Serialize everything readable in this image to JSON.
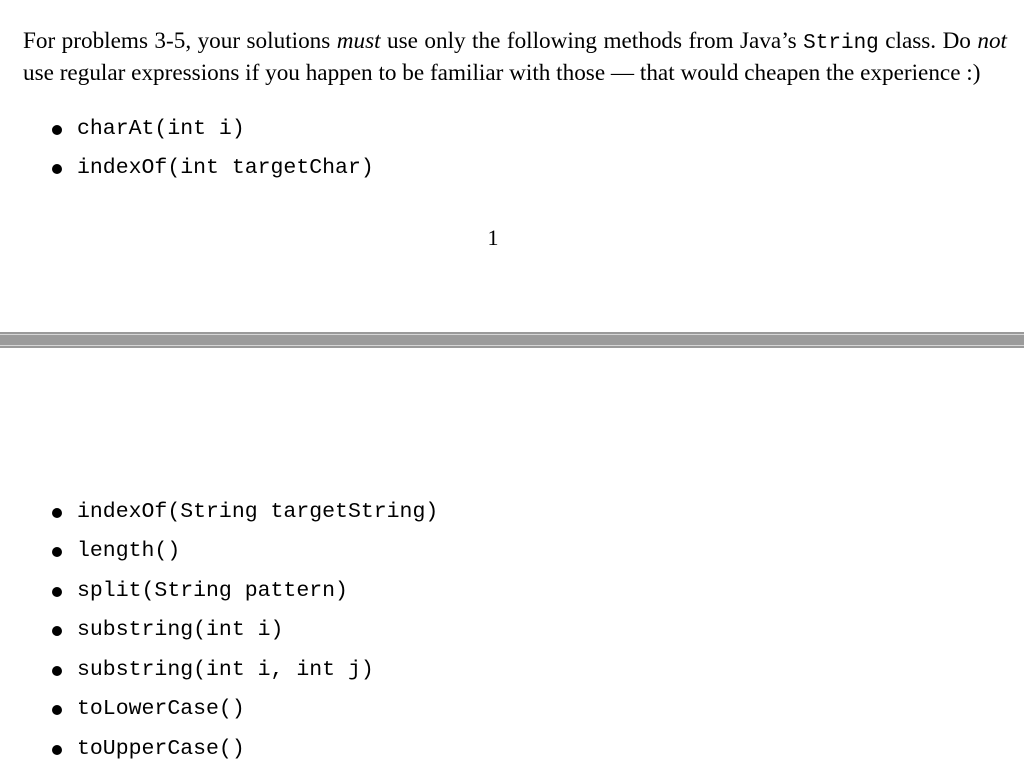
{
  "page1": {
    "intro": {
      "line1_part1": "For problems 3-5, your solutions ",
      "line1_em": "must",
      "line1_part2": " use only the following methods from Java’s ",
      "line1_code": "String",
      "line1_part3": " class.",
      "line2_part1": " Do ",
      "line2_em": "not",
      "line2_part2": " use regular expressions if you happen to be familiar with those — that would cheapen the experience :)"
    },
    "methods": [
      "charAt(int i)",
      "indexOf(int targetChar)"
    ],
    "page_number": "1"
  },
  "page2": {
    "methods": [
      "indexOf(String targetString)",
      "length()",
      "split(String pattern)",
      "substring(int i)",
      "substring(int i, int j)",
      "toLowerCase()",
      "toUpperCase()"
    ]
  },
  "colors": {
    "page_background": "#ffffff",
    "separator_gray": "#9b9b9b",
    "separator_highlight": "#d6d6d6",
    "text": "#000000"
  }
}
